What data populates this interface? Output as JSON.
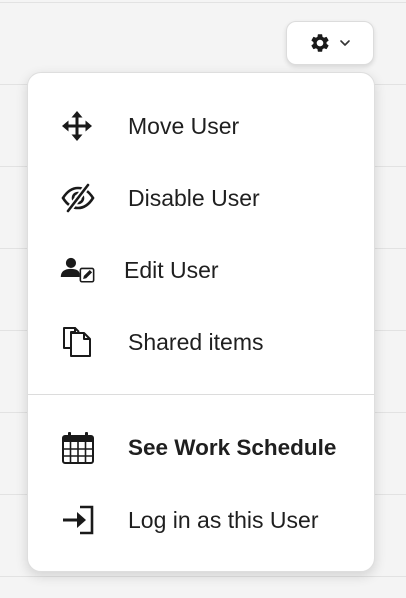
{
  "settings_button": {
    "icon": "gear-icon",
    "caret": "chevron-down-icon"
  },
  "menu": {
    "items": [
      {
        "label": "Move User",
        "icon": "move-arrows-icon"
      },
      {
        "label": "Disable User",
        "icon": "eye-slash-icon"
      },
      {
        "label": "Edit User",
        "icon": "user-edit-icon"
      },
      {
        "label": "Shared items",
        "icon": "shared-files-icon"
      },
      {
        "label": "See Work Schedule",
        "icon": "calendar-icon"
      },
      {
        "label": "Log in as this User",
        "icon": "login-icon"
      }
    ]
  },
  "colors": {
    "icon": "#1a1a1a",
    "text": "#1f1f1f",
    "background": "#f4f4f4",
    "menu_background": "#ffffff"
  }
}
